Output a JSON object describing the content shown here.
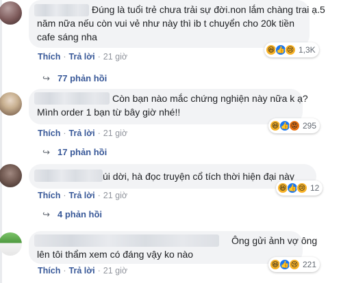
{
  "comments": [
    {
      "text_lines": [
        "Đúng là tuổi trẻ chưa trải sự đời.non lắm chàng trai ạ.5",
        "năm nữa nếu còn vui vẻ như này thì ib t chuyển cho 20k tiền",
        "cafe sáng nha"
      ],
      "like_label": "Thích",
      "reply_label": "Trả lời",
      "time": "21 giờ",
      "reaction_icons": [
        "haha-icon",
        "like-icon",
        "sad-icon"
      ],
      "reaction_count": "1,3K",
      "replies_label": "77 phản hồi"
    },
    {
      "text_lines": [
        "Còn bạn nào mắc chứng nghiện này nữa k ạ?",
        "Mình order 1 bạn từ bây giờ nhé!!"
      ],
      "like_label": "Thích",
      "reply_label": "Trả lời",
      "time": "21 giờ",
      "reaction_icons": [
        "haha-icon",
        "like-icon",
        "angry-icon"
      ],
      "reaction_count": "295",
      "replies_label": "17 phản hồi"
    },
    {
      "text_lines": [
        "úi dời, hà đọc truyện cổ tích thời hiện đại này"
      ],
      "like_label": "Thích",
      "reply_label": "Trả lời",
      "time": "21 giờ",
      "reaction_icons": [
        "haha-icon",
        "like-icon",
        "sad-icon"
      ],
      "reaction_count": "12",
      "replies_label": "4 phản hồi"
    },
    {
      "text_lines": [
        "Ông gửi ảnh vợ ông",
        "lên tôi thẩm xem có đáng vậy ko nào"
      ],
      "like_label": "Thích",
      "reply_label": "Trả lời",
      "time": "21 giờ",
      "reaction_icons": [
        "haha-icon",
        "like-icon",
        "sad-icon"
      ],
      "reaction_count": "221",
      "replies_label": ""
    }
  ],
  "colors": {
    "link": "#385898",
    "bubble": "#f2f3f5",
    "meta": "#90949c"
  }
}
